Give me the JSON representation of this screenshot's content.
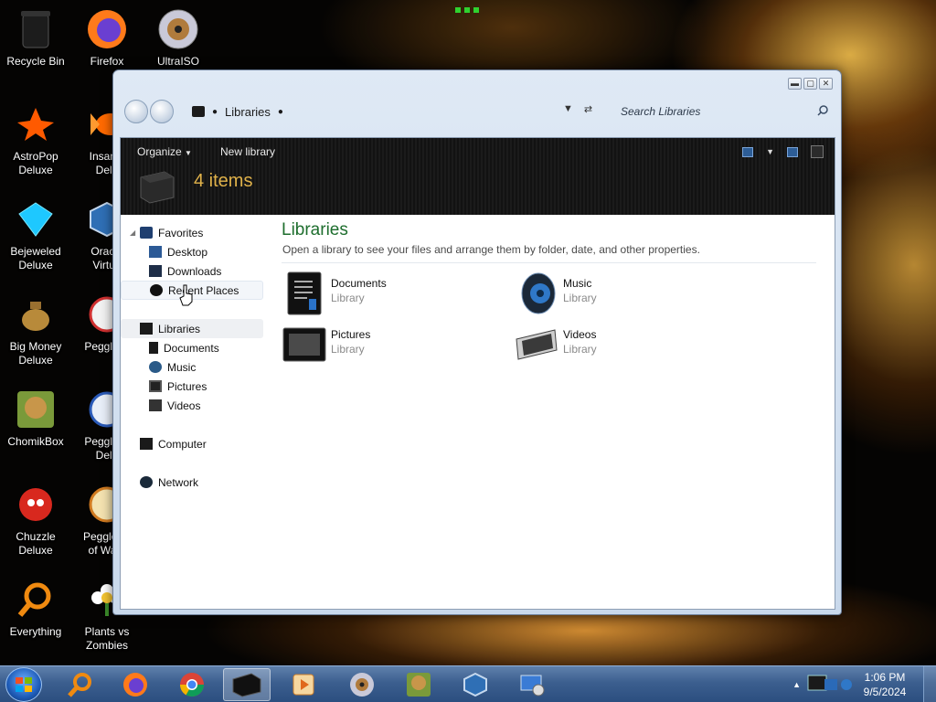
{
  "desktop": {
    "icons": [
      {
        "label": "Recycle Bin",
        "icon": "recycle-bin-icon"
      },
      {
        "label": "Firefox",
        "icon": "firefox-icon"
      },
      {
        "label": "UltraISO",
        "icon": "disc-icon"
      },
      {
        "label": "AstroPop\nDeluxe",
        "icon": "astropop-icon"
      },
      {
        "label": "Insaniq\nDelu",
        "icon": "fish-icon"
      },
      {
        "label": "Bejeweled\nDeluxe",
        "icon": "gem-icon"
      },
      {
        "label": "Oracle\nVirtua",
        "icon": "virtualbox-icon"
      },
      {
        "label": "Big Money\nDeluxe",
        "icon": "money-bag-icon"
      },
      {
        "label": "Peggle D",
        "icon": "peggle-icon"
      },
      {
        "label": "ChomikBox",
        "icon": "chomikbox-icon"
      },
      {
        "label": "Peggle N\nDelu",
        "icon": "peggle-icon"
      },
      {
        "label": "Chuzzle\nDeluxe",
        "icon": "chuzzle-icon"
      },
      {
        "label": "Peggle W\nof Warc",
        "icon": "peggle-icon"
      },
      {
        "label": "Everything",
        "icon": "magnifier-icon"
      },
      {
        "label": "Plants vs\nZombies",
        "icon": "flower-icon"
      }
    ]
  },
  "window": {
    "address": {
      "location": "Libraries"
    },
    "search": {
      "placeholder": "Search Libraries"
    },
    "toolbar": {
      "organize_label": "Organize",
      "new_library_label": "New library",
      "item_count": "4 items"
    },
    "nav": {
      "favorites_label": "Favorites",
      "favorites": [
        "Desktop",
        "Downloads",
        "Recent Places"
      ],
      "libraries_label": "Libraries",
      "libraries": [
        "Documents",
        "Music",
        "Pictures",
        "Videos"
      ],
      "computer_label": "Computer",
      "network_label": "Network"
    },
    "main": {
      "title": "Libraries",
      "description": "Open a library to see your files and arrange them by folder, date, and other properties.",
      "items": [
        {
          "name": "Documents",
          "type": "Library",
          "icon": "documents-library-icon"
        },
        {
          "name": "Music",
          "type": "Library",
          "icon": "speaker-icon"
        },
        {
          "name": "Pictures",
          "type": "Library",
          "icon": "picture-frame-icon"
        },
        {
          "name": "Videos",
          "type": "Library",
          "icon": "film-reel-icon"
        }
      ]
    }
  },
  "taskbar": {
    "apps": [
      "start-orb-icon",
      "everything-icon",
      "firefox-icon",
      "chrome-icon",
      "explorer-icon",
      "media-player-icon",
      "ultraiso-icon",
      "chomikbox-icon",
      "virtualbox-icon",
      "control-panel-icon"
    ],
    "clock": {
      "time": "1:06 PM",
      "date": "9/5/2024"
    }
  },
  "colors": {
    "accent_green": "#1e6e2e",
    "item_count_gold": "#e0b24a",
    "taskbar_blue": "#3c5f8f"
  }
}
